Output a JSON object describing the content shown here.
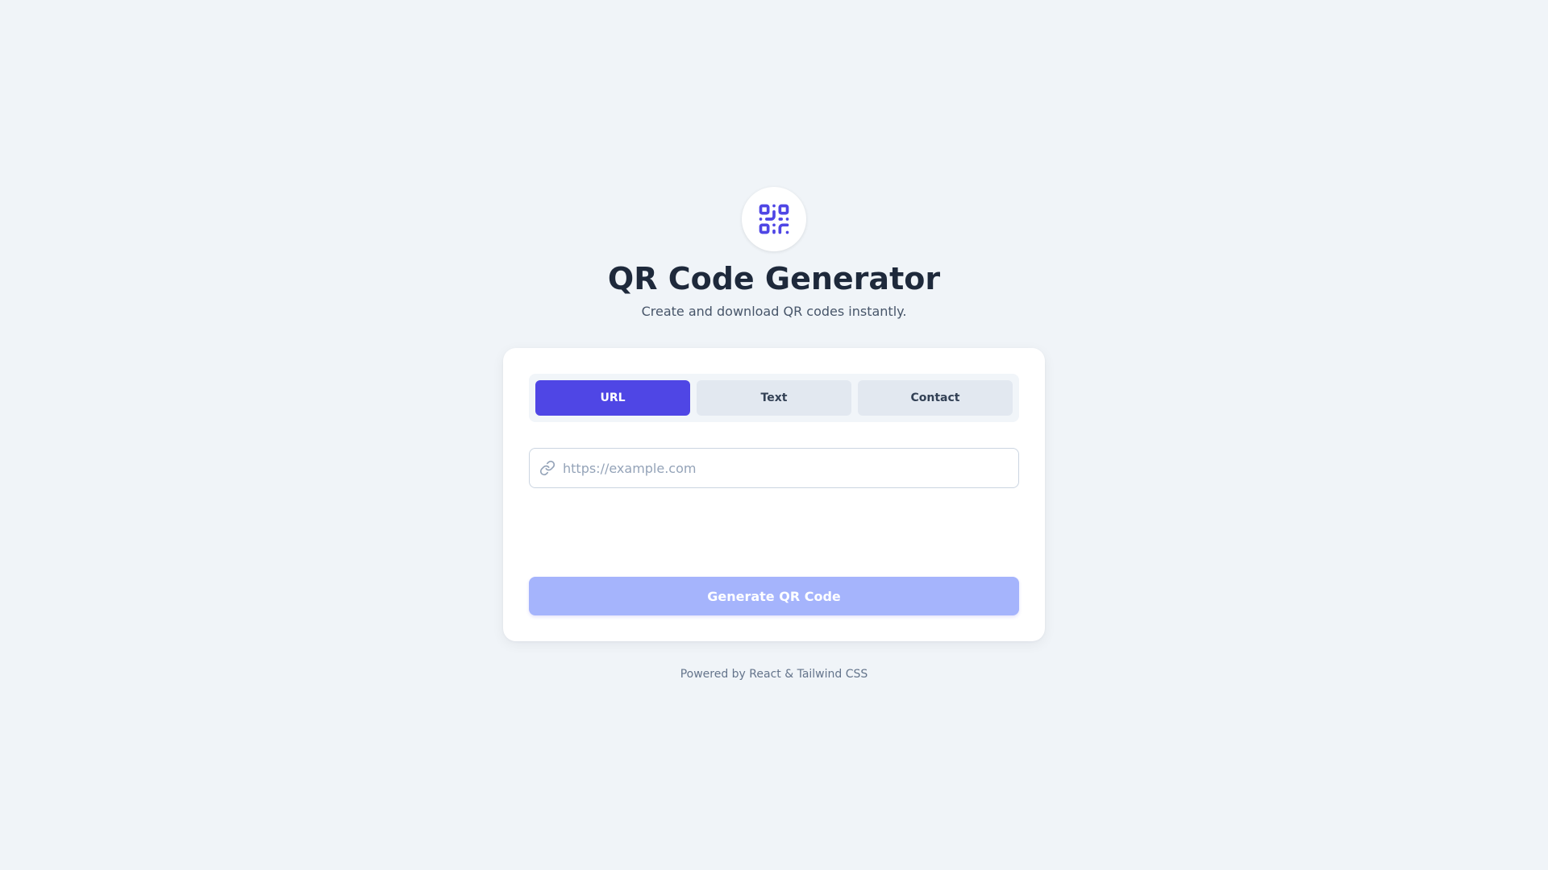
{
  "header": {
    "title": "QR Code Generator",
    "subtitle": "Create and download QR codes instantly.",
    "logo_icon": "qr-code-icon"
  },
  "tabs": [
    {
      "label": "URL",
      "active": true
    },
    {
      "label": "Text",
      "active": false
    },
    {
      "label": "Contact",
      "active": false
    }
  ],
  "input": {
    "icon": "link-icon",
    "placeholder": "https://example.com",
    "value": ""
  },
  "generate_button": {
    "label": "Generate QR Code",
    "enabled": false
  },
  "footer": {
    "text": "Powered by React & Tailwind CSS"
  },
  "colors": {
    "accent": "#4f46e5",
    "accent_disabled": "#a5b4fc",
    "background": "#f0f4f8",
    "title": "#1e293b"
  }
}
